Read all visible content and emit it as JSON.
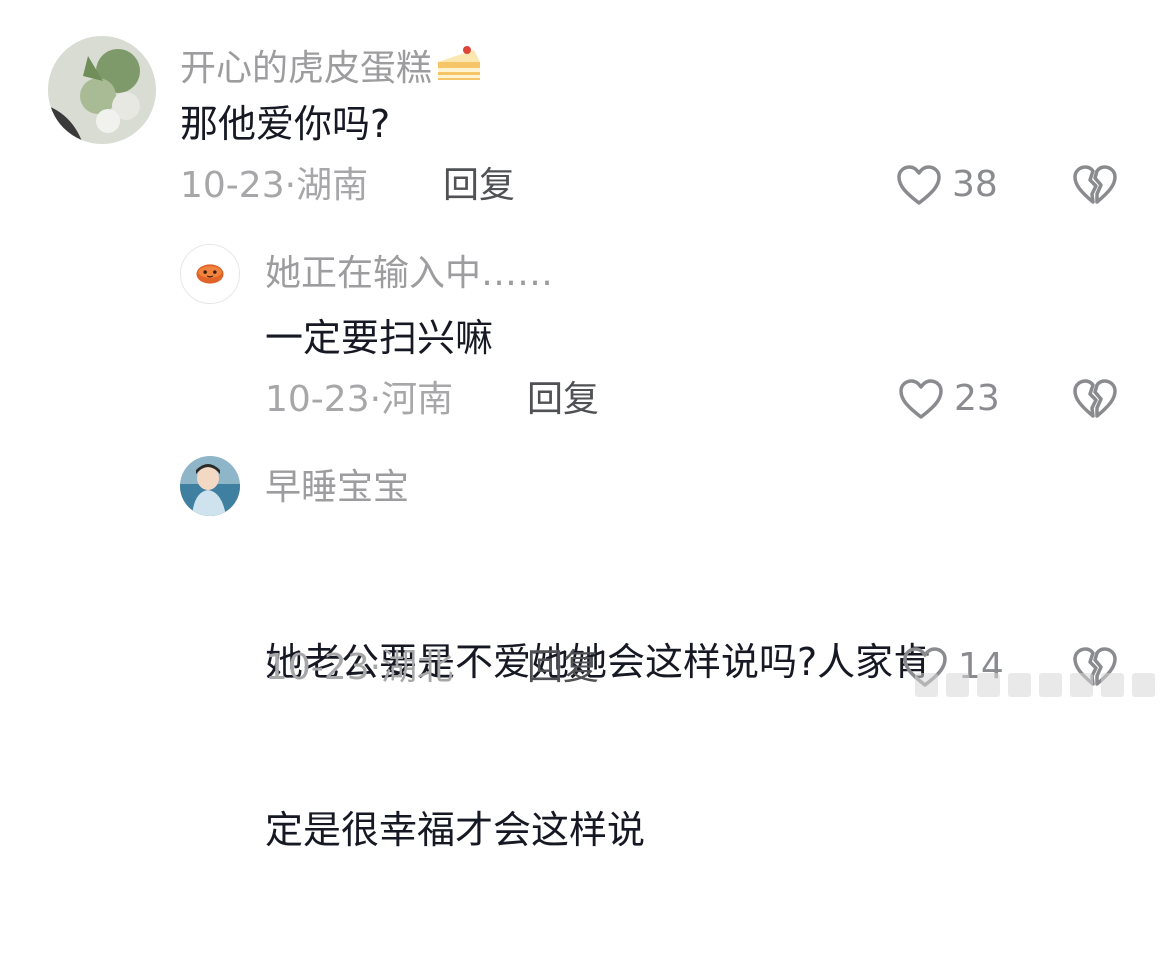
{
  "comments": [
    {
      "username": "开心的虎皮蛋糕",
      "username_emoji": "cake-emoji",
      "text": "那他爱你吗?",
      "date": "10-23·",
      "location": "湖南",
      "reply_label": "回复",
      "likes": "38"
    },
    {
      "username": "她正在输入中……",
      "text": "一定要扫兴嘛",
      "date": "10-23·",
      "location": "河南",
      "reply_label": "回复",
      "likes": "23"
    },
    {
      "username": "早睡宝宝",
      "text_line1": "她老公要是不爱她她会这样说吗?人家肯",
      "text_line2": "定是很幸福才会这样说",
      "date": "10-23·",
      "location": "湖北",
      "reply_label": "回复",
      "likes": "14"
    }
  ],
  "colors": {
    "username": "#9d9d9f",
    "text": "#161823",
    "meta": "#a7a7a9",
    "icon": "#8a8b8e"
  }
}
